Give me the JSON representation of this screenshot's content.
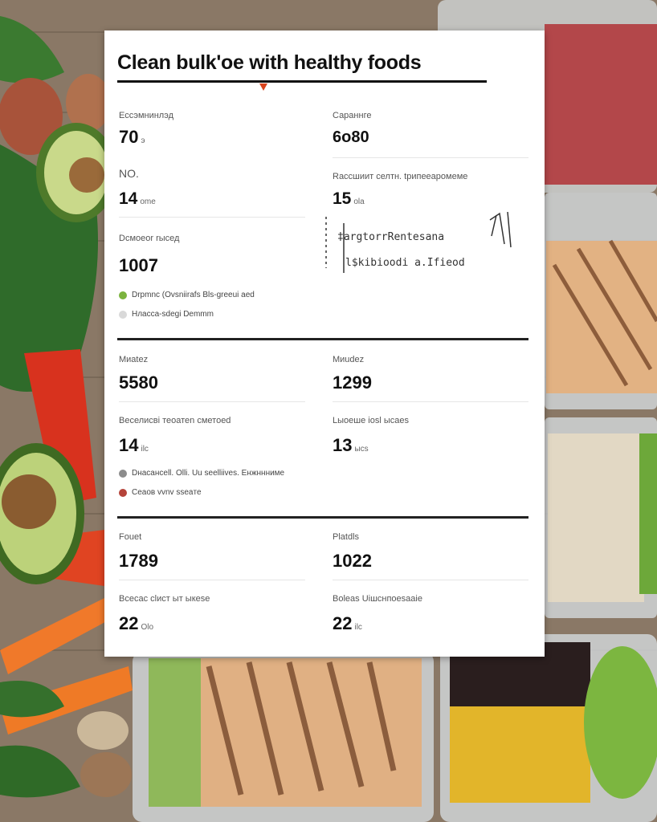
{
  "card": {
    "title": "Clean bulk'oe with healthy foods",
    "sections": [
      {
        "rows": [
          {
            "left": {
              "label": "Ессэмнинлэд",
              "value": "70",
              "unit": "э"
            },
            "right": {
              "label": "Сараннге",
              "value": "6о80",
              "unit": ""
            }
          },
          {
            "left": {
              "label": "NO.",
              "value": "14",
              "unit": "ome"
            },
            "right": {
              "label": "Rассшиит селтн. tрипееаромеме",
              "value": "15",
              "unit": "оlа"
            }
          },
          {
            "left": {
              "label": "Dсмоеоr rысед",
              "value": "1007",
              "unit": ""
            },
            "right": {
              "label": "",
              "value": "",
              "unit": ""
            }
          }
        ],
        "handwritten": [
          "‡argtorrRentesana",
          "l$kibioodi a.Ifieod"
        ],
        "legend": [
          {
            "text": "Drpmnc (Ovsniirafs Bls-greeui aed",
            "color": "#7bb33e"
          },
          {
            "text": "Нласса-sdegi Demmm",
            "color": "#d9d9d9"
          }
        ]
      },
      {
        "rows": [
          {
            "left": {
              "label": "Mиatez",
              "value": "5580",
              "unit": ""
            },
            "right": {
              "label": "Mиudez",
              "value": "1299",
              "unit": ""
            }
          },
          {
            "left": {
              "label": "Веселисвi теоатеn сметоеd",
              "value": "14",
              "unit": "ilc"
            },
            "right": {
              "label": "Lыоеше iosl ысaеs",
              "value": "13",
              "unit": "ыcs"
            }
          }
        ],
        "legend": [
          {
            "text": "Dнасанcell. Olli. Uu seelliives. Eнжннниме",
            "color": "#8c8c8c"
          },
          {
            "text": "Сеаов vvnv sseaтe",
            "color": "#b5433a"
          }
        ]
      },
      {
        "rows": [
          {
            "left": {
              "label": "Fouet",
              "value": "1789",
              "unit": ""
            },
            "right": {
              "label": "Platdls",
              "value": "1022",
              "unit": ""
            }
          },
          {
            "left": {
              "label": "Всесас сlист ыт ыкеsе",
              "value": "22",
              "unit": "Оlо"
            },
            "right": {
              "label": "Bolеаs Uiшснпоеsaaiе",
              "value": "22",
              "unit": "ilс"
            }
          }
        ]
      }
    ]
  },
  "colors": {
    "accent": "#d8431c",
    "rule": "#222222",
    "card": "#ffffff"
  }
}
